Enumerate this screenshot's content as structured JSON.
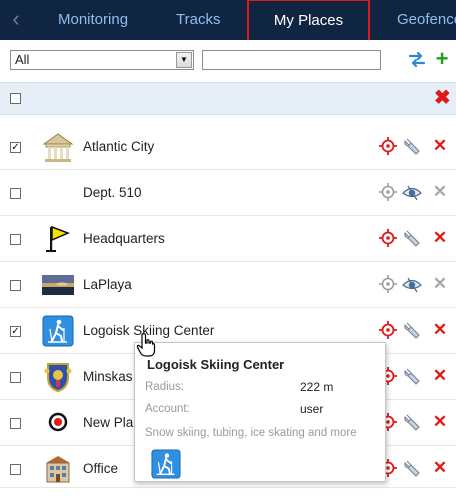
{
  "tabs": {
    "back_label": "‹",
    "items": [
      "Monitoring",
      "Tracks",
      "My Places",
      "Geofence"
    ],
    "active": "My Places"
  },
  "filter": {
    "selected": "All",
    "search_value": "",
    "search_placeholder": ""
  },
  "places": [
    {
      "name": "Atlantic City",
      "checked": true,
      "icon": "building-columns-icon",
      "tracked": true,
      "action": "edit-wrench",
      "delete_color": "#e01818"
    },
    {
      "name": "Dept. 510",
      "checked": false,
      "icon": "none",
      "tracked": false,
      "action": "view-eye",
      "delete_color": "#a9a9a9"
    },
    {
      "name": "Headquarters",
      "checked": false,
      "icon": "yellow-flag-icon",
      "tracked": true,
      "action": "edit-wrench",
      "delete_color": "#e01818"
    },
    {
      "name": "LaPlaya",
      "checked": false,
      "icon": "beach-photo-icon",
      "tracked": false,
      "action": "view-eye",
      "delete_color": "#a9a9a9"
    },
    {
      "name": "Logoisk Skiing Center",
      "checked": true,
      "icon": "skier-icon",
      "tracked": true,
      "action": "edit-wrench",
      "delete_color": "#e01818"
    },
    {
      "name": "Minskas",
      "checked": false,
      "icon": "coat-of-arms-icon",
      "tracked": true,
      "action": "edit-wrench",
      "delete_color": "#e01818"
    },
    {
      "name": "New Pla",
      "checked": false,
      "icon": "red-circle-marker-icon",
      "tracked": true,
      "action": "edit-wrench",
      "delete_color": "#e01818"
    },
    {
      "name": "Office",
      "checked": false,
      "icon": "office-building-icon",
      "tracked": true,
      "action": "edit-wrench",
      "delete_color": "#e01818"
    }
  ],
  "tooltip": {
    "title": "Logoisk Skiing Center",
    "radius_label": "Radius:",
    "radius_value": "222 m",
    "account_label": "Account:",
    "account_value": "user",
    "description": "Snow skiing, tubing, ice skating and more",
    "icon": "skier-icon"
  },
  "colors": {
    "tabbar_bg": "#0f2541",
    "tab_text": "#8fbef0",
    "active_tab_border": "#e01a1a",
    "header_row_bg": "#e6eef7",
    "delete_red": "#e01818",
    "add_green": "#1fa01f"
  }
}
